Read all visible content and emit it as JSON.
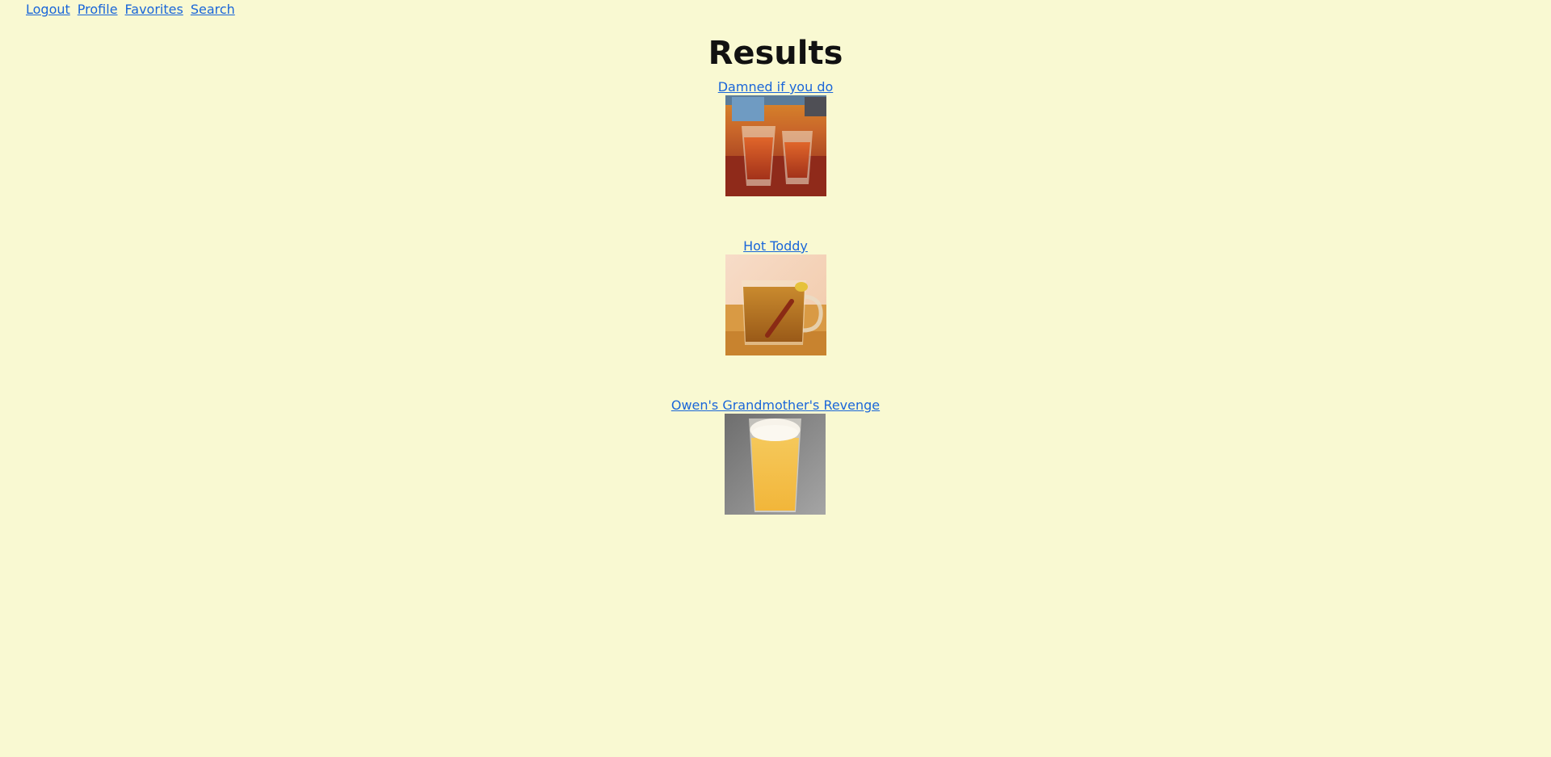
{
  "nav": {
    "logout": "Logout",
    "profile": "Profile",
    "favorites": "Favorites",
    "search": "Search"
  },
  "page": {
    "title": "Results"
  },
  "results": [
    {
      "name": "Damned if you do",
      "image": "two-shot-glasses-amber-drink-image"
    },
    {
      "name": "Hot Toddy",
      "image": "glass-mug-tea-cinnamon-image"
    },
    {
      "name": "Owen's Grandmother's Revenge",
      "image": "pint-glass-yellow-foamy-drink-image"
    }
  ],
  "colors": {
    "background": "#f9f9d2",
    "link": "#1a66d9"
  }
}
